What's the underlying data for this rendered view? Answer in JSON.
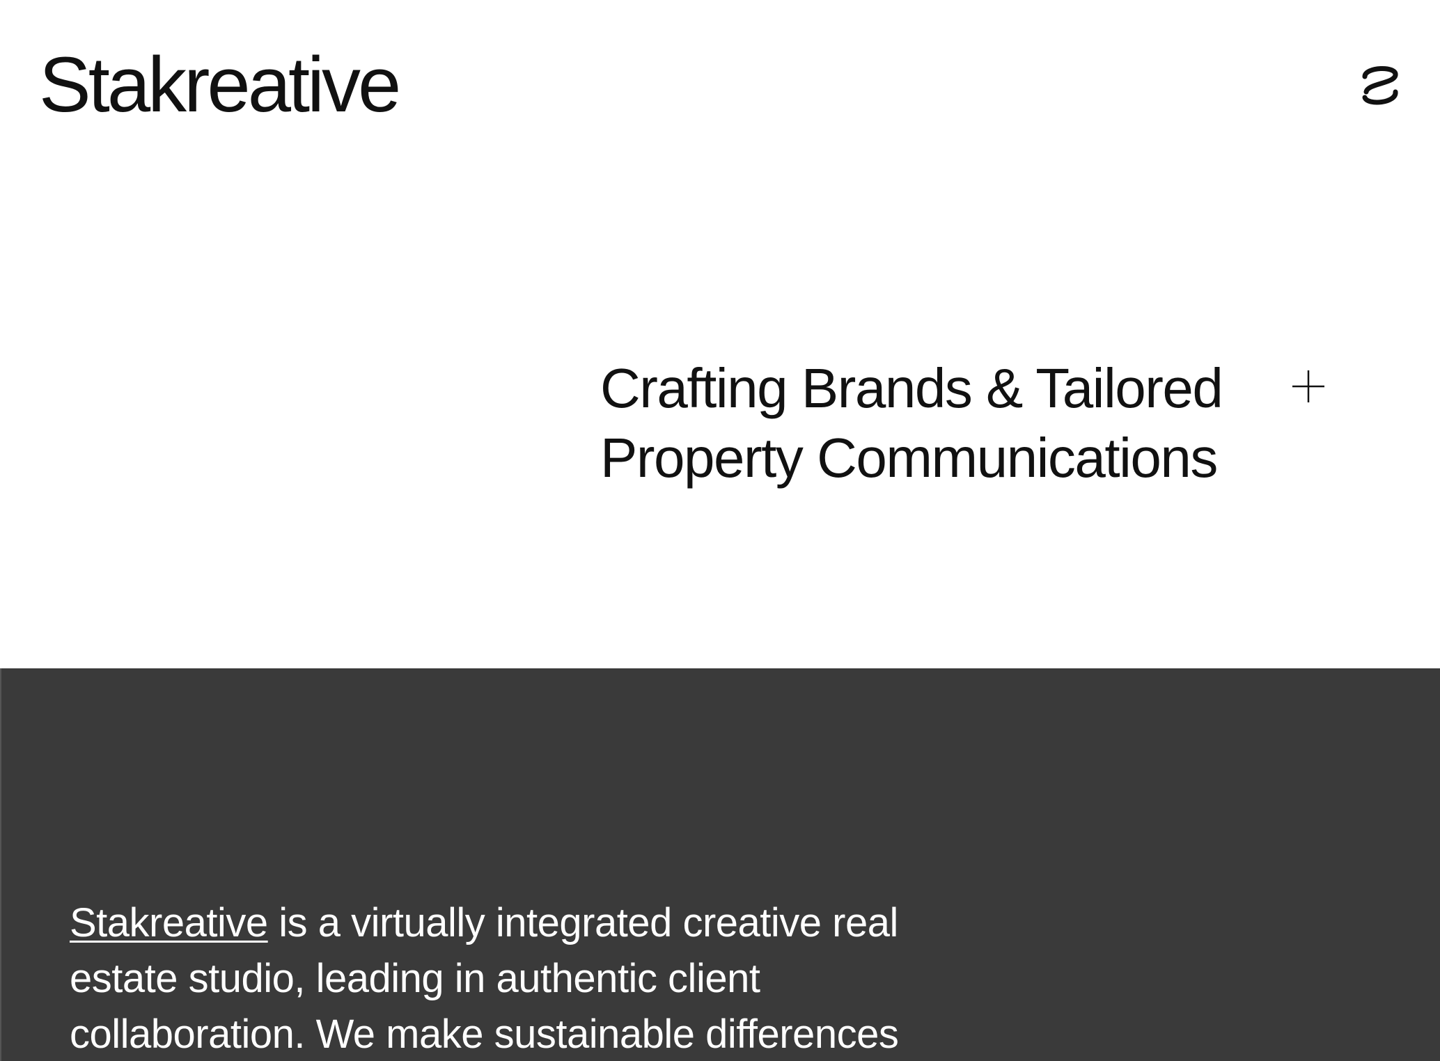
{
  "header": {
    "brand": "Stakreative",
    "menu_icon": "stakreative-s-icon"
  },
  "hero": {
    "tagline_line1": "Crafting Brands & Tailored",
    "tagline_line2": "Property Communications",
    "expand_icon": "plus-icon"
  },
  "about": {
    "link_text": "Stakreative",
    "line1_rest": " is a virtually integrated creative real",
    "line2": "estate studio, leading in authentic client",
    "line3": "collaboration. We make sustainable differences"
  },
  "colors": {
    "background": "#ffffff",
    "text_dark": "#111111",
    "section_dark": "#3a3a3a",
    "text_light": "#ffffff"
  }
}
